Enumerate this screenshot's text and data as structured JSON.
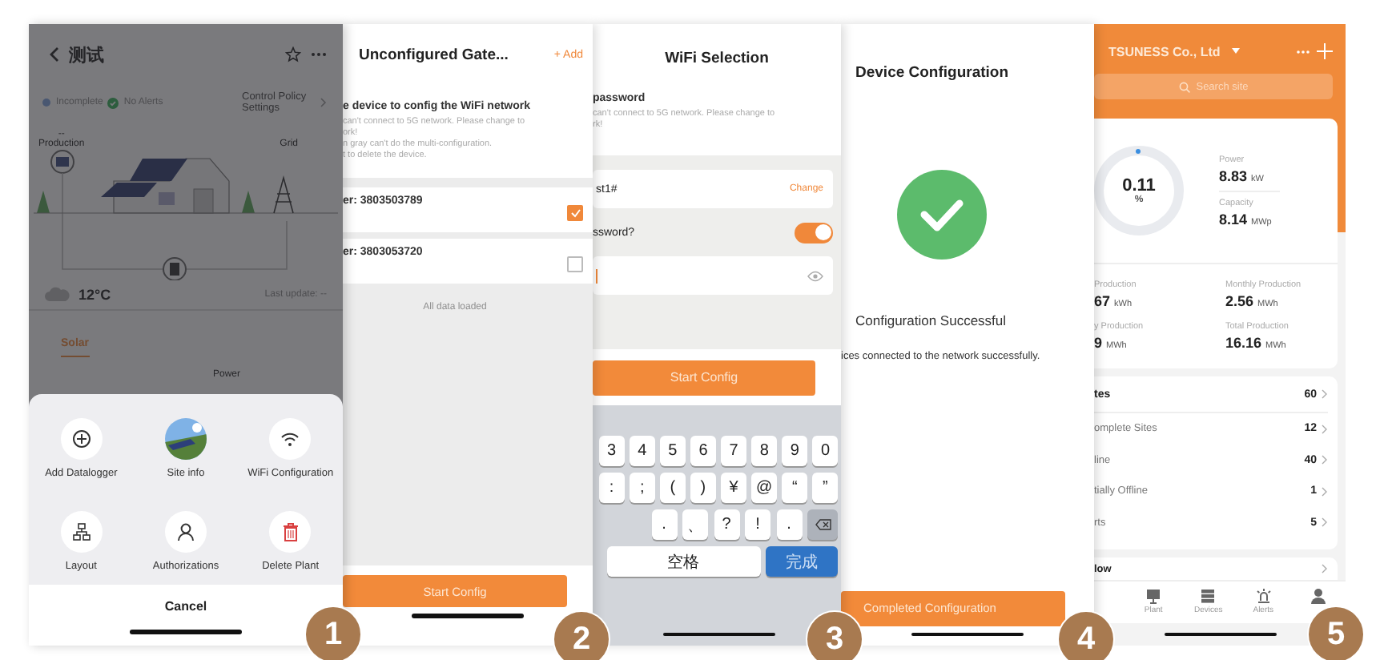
{
  "plant_screen": {
    "title": "测试",
    "status": [
      {
        "label": "Incomplete",
        "kind": "pending"
      },
      {
        "label": "No Alerts",
        "kind": "ok"
      }
    ],
    "control_policy": "Control Policy Settings",
    "production_value": "--",
    "production_label": "Production",
    "grid_label": "Grid",
    "temperature": "12°C",
    "last_update": "Last update: --",
    "tabs": [
      {
        "label": "Solar",
        "selected": true
      }
    ],
    "power_label": "Power",
    "actions": [
      {
        "label": "Add Datalogger",
        "kind": "plus"
      },
      {
        "label": "Site info"
      },
      {
        "label": "WiFi Configuration",
        "kind": "wifi"
      },
      {
        "label": "Layout",
        "kind": "tree"
      },
      {
        "label": "Authorizations",
        "kind": "user"
      },
      {
        "label": "Delete Plant",
        "kind": "trash"
      }
    ],
    "cancel": "Cancel"
  },
  "gateway_screen": {
    "title": "Unconfigured Gate...",
    "add": "+ Add",
    "instruction": "e device to config the WiFi network",
    "notes": [
      "can't connect to 5G network. Please change to",
      "ork!",
      "n gray can't do the multi-configuration.",
      "t to delete the device."
    ],
    "devices": [
      {
        "label": "er: 3803503789",
        "checked": true
      },
      {
        "label": "er: 3803053720",
        "checked": false
      }
    ],
    "footer_note": "All data loaded",
    "button": "Start Config"
  },
  "wifi_screen": {
    "title": "WiFi Selection",
    "subtitle": "password",
    "notes": [
      "can't connect to 5G network. Please change to",
      "rk!"
    ],
    "network": "st1#",
    "change": "Change",
    "password_question": "ssword?",
    "password_toggle_on": true,
    "button": "Start Config",
    "keyboard_rows": [
      [
        "3",
        "4",
        "5",
        "6",
        "7",
        "8",
        "9",
        "0"
      ],
      [
        ":",
        ";",
        "(",
        ")",
        "¥",
        "@",
        "“",
        "”"
      ],
      [
        ".",
        "、",
        "?",
        "!",
        "."
      ]
    ],
    "space": "空格",
    "done": "完成"
  },
  "result_screen": {
    "title": "Device Configuration",
    "success": "Configuration Successful",
    "message": "ices connected to the network successfully.",
    "button": "Completed Configuration"
  },
  "dashboard_screen": {
    "company": "TSUNESS Co., Ltd",
    "search_placeholder": "Search site",
    "ratio": "0.11",
    "ratio_unit": "%",
    "metrics": [
      {
        "label": "Power",
        "value": "8.83",
        "unit": "kW"
      },
      {
        "label": "Capacity",
        "value": "8.14",
        "unit": "MWp"
      }
    ],
    "production": [
      {
        "label": "Production",
        "value": "67",
        "unit": "kWh"
      },
      {
        "label": "Monthly Production",
        "value": "2.56",
        "unit": "MWh"
      },
      {
        "label": "y Production",
        "value": "9",
        "unit": "MWh"
      },
      {
        "label": "Total Production",
        "value": "16.16",
        "unit": "MWh"
      }
    ],
    "sites": [
      {
        "label": "tes",
        "count": "60",
        "kind": "total"
      },
      {
        "label": "omplete Sites",
        "count": "12",
        "kind": "status"
      },
      {
        "label": "line",
        "count": "40",
        "kind": "status"
      },
      {
        "label": "tially Offline",
        "count": "1",
        "kind": "status"
      },
      {
        "label": "rts",
        "count": "5",
        "kind": "status"
      }
    ],
    "flow": "low",
    "nav": [
      {
        "label": "Plant",
        "kind": "plant"
      },
      {
        "label": "Devices",
        "kind": "devices"
      },
      {
        "label": "Alerts",
        "kind": "alerts"
      },
      {
        "kind": "me"
      }
    ]
  },
  "step_badges": [
    "1",
    "2",
    "3",
    "4",
    "5"
  ]
}
